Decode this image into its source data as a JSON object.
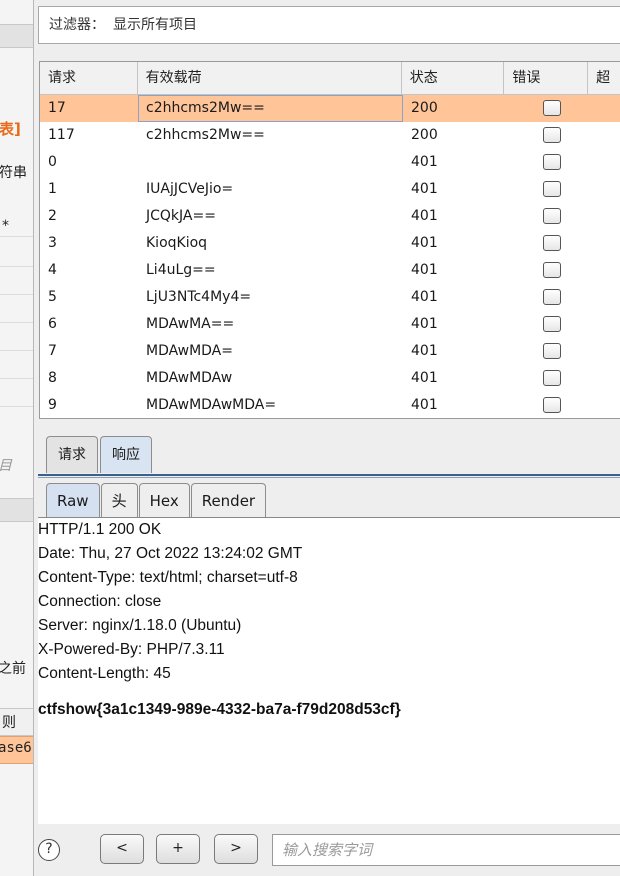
{
  "left_pane": {
    "bracket_text": "表]",
    "string_text": "符串",
    "asterisk_text": "*",
    "item_text": "目",
    "before_text": "之前",
    "rule_text": "则",
    "case_text": "ase6"
  },
  "filter": {
    "label": "过滤器：",
    "value": "显示所有项目"
  },
  "results_table": {
    "columns": [
      "请求",
      "有效载荷",
      "状态",
      "错误",
      "超"
    ],
    "rows": [
      {
        "request": "17",
        "payload": "c2hhcms2Mw==",
        "status": "200",
        "selected": true
      },
      {
        "request": "117",
        "payload": "c2hhcms2Mw==",
        "status": "200",
        "selected": false
      },
      {
        "request": "0",
        "payload": "",
        "status": "401",
        "selected": false
      },
      {
        "request": "1",
        "payload": "IUAjJCVeJio=",
        "status": "401",
        "selected": false
      },
      {
        "request": "2",
        "payload": "JCQkJA==",
        "status": "401",
        "selected": false
      },
      {
        "request": "3",
        "payload": "KioqKioq",
        "status": "401",
        "selected": false
      },
      {
        "request": "4",
        "payload": "Li4uLg==",
        "status": "401",
        "selected": false
      },
      {
        "request": "5",
        "payload": "LjU3NTc4My4=",
        "status": "401",
        "selected": false
      },
      {
        "request": "6",
        "payload": "MDAwMA==",
        "status": "401",
        "selected": false
      },
      {
        "request": "7",
        "payload": "MDAwMDA=",
        "status": "401",
        "selected": false
      },
      {
        "request": "8",
        "payload": "MDAwMDAw",
        "status": "401",
        "selected": false
      },
      {
        "request": "9",
        "payload": "MDAwMDAwMDA=",
        "status": "401",
        "selected": false
      }
    ]
  },
  "detail_tabs": [
    "请求",
    "响应"
  ],
  "active_detail_tab": "响应",
  "view_tabs": [
    "Raw",
    "头",
    "Hex",
    "Render"
  ],
  "active_view_tab": "Raw",
  "response": {
    "lines": [
      "HTTP/1.1 200 OK",
      "Date: Thu, 27 Oct 2022 13:24:02 GMT",
      "Content-Type: text/html; charset=utf-8",
      "Connection: close",
      "Server: nginx/1.18.0 (Ubuntu)",
      "X-Powered-By: PHP/7.3.11",
      "Content-Length: 45"
    ],
    "body": "ctfshow{3a1c1349-989e-4332-ba7a-f79d208d53cf}"
  },
  "bottom_bar": {
    "help_label": "?",
    "prev_label": "<",
    "add_label": "+",
    "next_label": ">",
    "search_placeholder": "输入搜索字词"
  },
  "colors": {
    "selected_row": "#ffc599",
    "tab_active": "#d5e1f0",
    "accent_line": "#3d5f8a",
    "left_accent": "#e86a1a"
  }
}
